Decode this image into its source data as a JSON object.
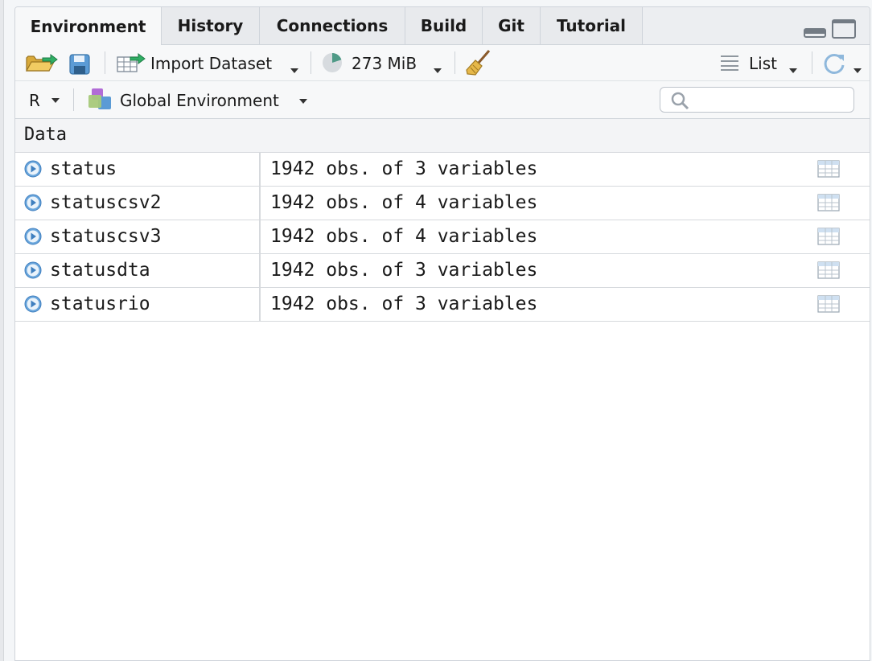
{
  "tabs": [
    {
      "label": "Environment",
      "active": true
    },
    {
      "label": "History",
      "active": false
    },
    {
      "label": "Connections",
      "active": false
    },
    {
      "label": "Build",
      "active": false
    },
    {
      "label": "Git",
      "active": false
    },
    {
      "label": "Tutorial",
      "active": false
    }
  ],
  "toolbar": {
    "import_label": "Import Dataset",
    "memory_label": "273 MiB",
    "view_label": "List",
    "icons": [
      "open-folder-icon",
      "save-icon",
      "import-dataset-icon",
      "memory-pie-icon",
      "broom-icon",
      "list-icon",
      "refresh-icon"
    ]
  },
  "env_bar": {
    "language": "R",
    "environment": "Global Environment",
    "search": {
      "placeholder": "",
      "value": ""
    }
  },
  "section": {
    "title": "Data"
  },
  "rows": [
    {
      "name": "status",
      "value": "1942 obs. of 3 variables"
    },
    {
      "name": "statuscsv2",
      "value": "1942 obs. of 4 variables"
    },
    {
      "name": "statuscsv3",
      "value": "1942 obs. of 4 variables"
    },
    {
      "name": "statusdta",
      "value": "1942 obs. of 3 variables"
    },
    {
      "name": "statusrio",
      "value": "1942 obs. of 3 variables"
    }
  ],
  "colors": {
    "expand": "#4d8fd0",
    "pane_bg": "#ffffff",
    "toolbar_bg": "#f7f8f9"
  }
}
